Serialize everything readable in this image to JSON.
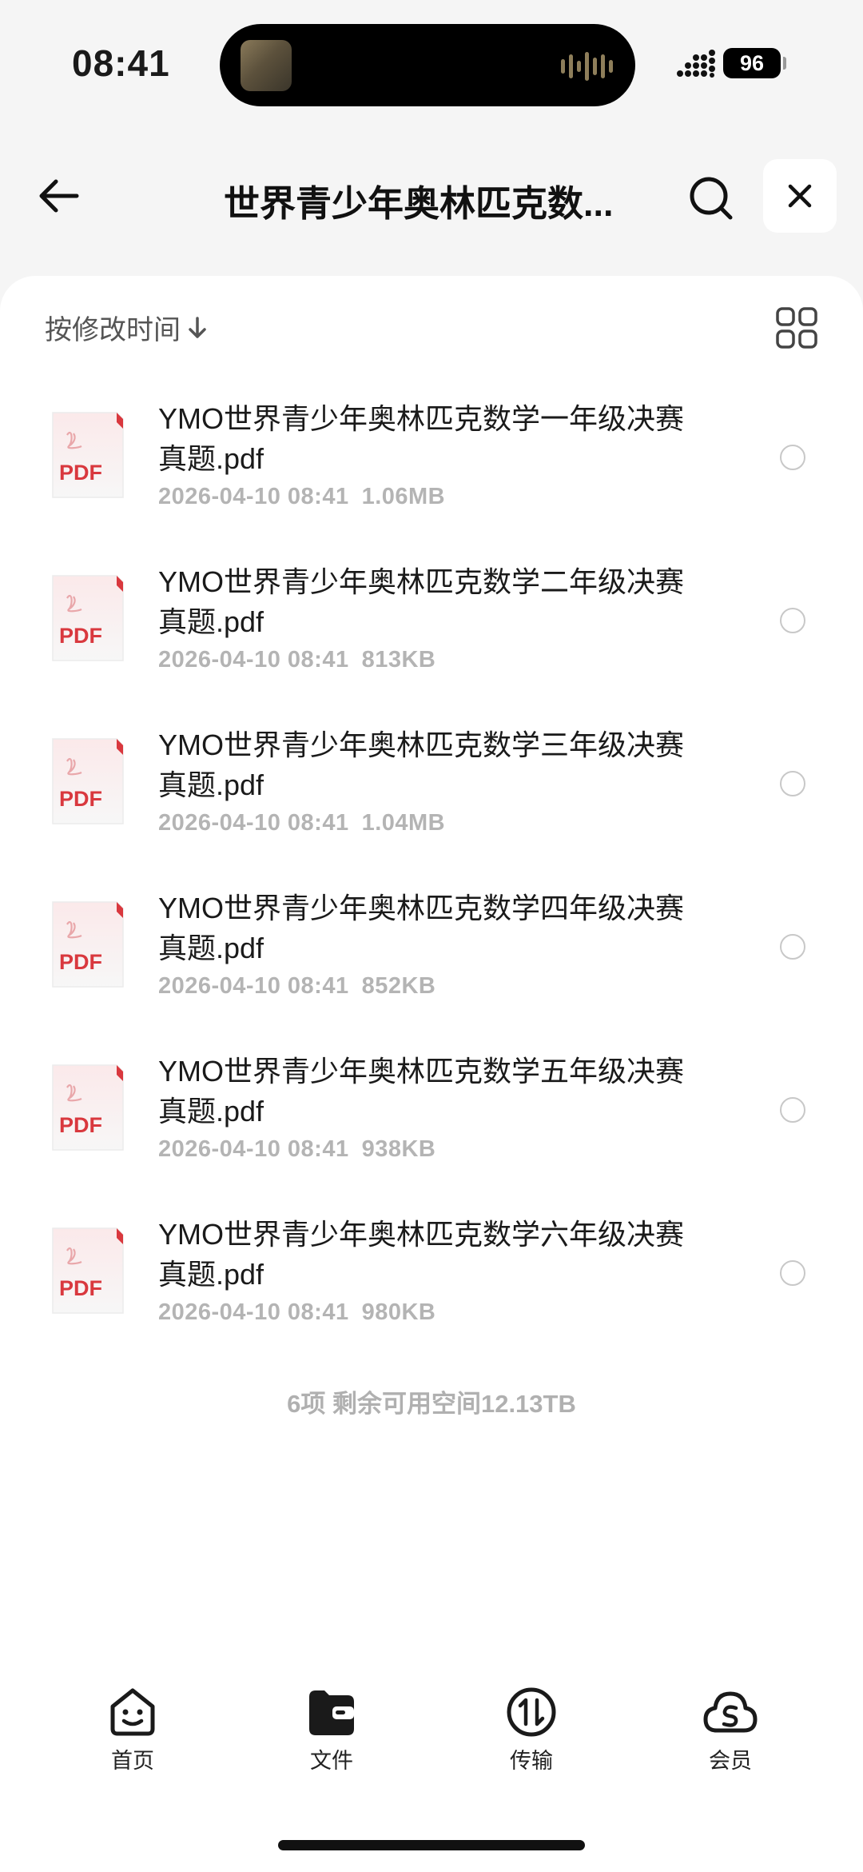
{
  "status": {
    "time": "08:41",
    "battery": "96"
  },
  "header": {
    "title": "世界青少年奥林匹克数..."
  },
  "sort": {
    "label": "按修改时间"
  },
  "files": [
    {
      "name": "YMO世界青少年奥林匹克数学一年级决赛真题.pdf",
      "date": "2026-04-10 08:41",
      "size": "1.06MB",
      "icon_text": "PDF"
    },
    {
      "name": "YMO世界青少年奥林匹克数学二年级决赛真题.pdf",
      "date": "2026-04-10 08:41",
      "size": "813KB",
      "icon_text": "PDF"
    },
    {
      "name": "YMO世界青少年奥林匹克数学三年级决赛真题.pdf",
      "date": "2026-04-10 08:41",
      "size": "1.04MB",
      "icon_text": "PDF"
    },
    {
      "name": "YMO世界青少年奥林匹克数学四年级决赛真题.pdf",
      "date": "2026-04-10 08:41",
      "size": "852KB",
      "icon_text": "PDF"
    },
    {
      "name": "YMO世界青少年奥林匹克数学五年级决赛真题.pdf",
      "date": "2026-04-10 08:41",
      "size": "938KB",
      "icon_text": "PDF"
    },
    {
      "name": "YMO世界青少年奥林匹克数学六年级决赛真题.pdf",
      "date": "2026-04-10 08:41",
      "size": "980KB",
      "icon_text": "PDF"
    }
  ],
  "summary": "6项 剩余可用空间12.13TB",
  "tabs": [
    {
      "label": "首页",
      "icon": "home-face-icon"
    },
    {
      "label": "文件",
      "icon": "folder-icon"
    },
    {
      "label": "传输",
      "icon": "transfer-icon"
    },
    {
      "label": "会员",
      "icon": "cloud-member-icon"
    }
  ],
  "colors": {
    "pdf_red": "#d9383e",
    "accent": "#111111"
  }
}
